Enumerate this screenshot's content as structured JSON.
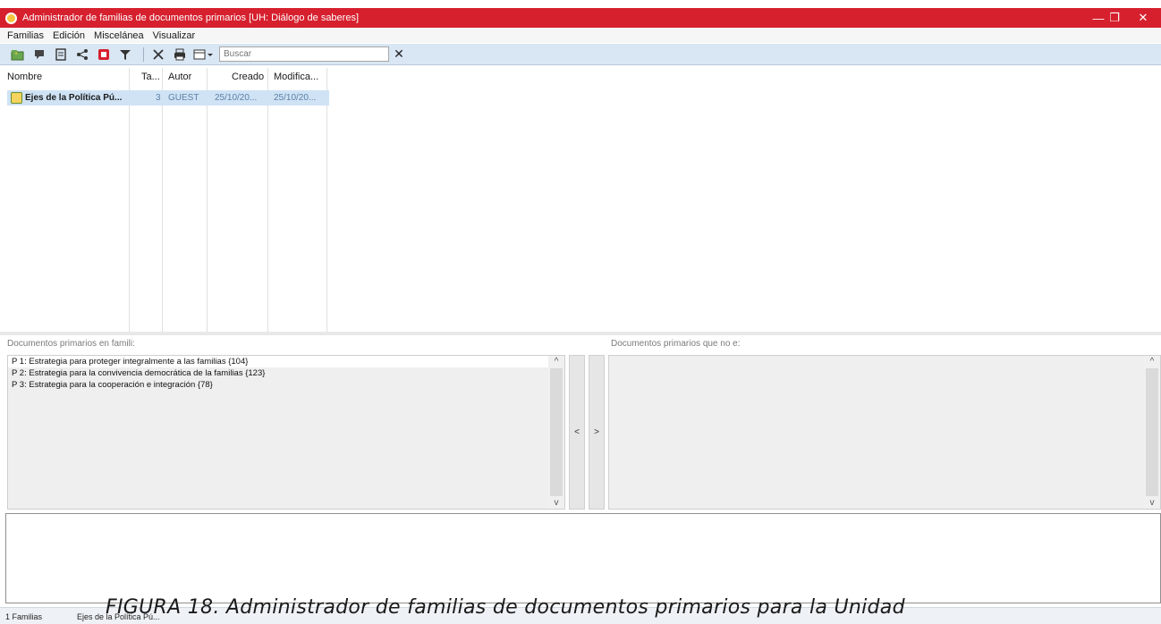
{
  "window": {
    "title": "Administrador de familias de documentos primarios [UH: Diálogo de saberes]",
    "minimize": "—",
    "maximize": "❐",
    "close": "✕"
  },
  "menu": [
    "Familias",
    "Edición",
    "Miscelánea",
    "Visualizar"
  ],
  "toolbar": {
    "icons": [
      "new-family-icon",
      "comment-icon",
      "document-icon",
      "network-icon",
      "record-icon",
      "filter-icon",
      "delete-icon",
      "print-icon",
      "view-icon"
    ],
    "search_placeholder": "Buscar",
    "search_clear": "✕"
  },
  "families_table": {
    "columns": [
      "Nombre",
      "Ta...",
      "Autor",
      "Creado",
      "Modifica..."
    ],
    "rows": [
      {
        "name": "Ejes de la Política Pú...",
        "size": "3",
        "author": "GUEST",
        "created": "25/10/20...",
        "modified": "25/10/20..."
      }
    ]
  },
  "left_pane": {
    "label": "Documentos primarios en famili:",
    "items": [
      "P 1: Estrategia para proteger integralmente a las familias {104}",
      "P 2: Estrategia para la convivencia democrática de la familias {123}",
      "P 3: Estrategia para la cooperación e integración {78}"
    ]
  },
  "right_pane": {
    "label": "Documentos primarios que no e:",
    "items": []
  },
  "move_buttons": {
    "left": "<",
    "right": ">"
  },
  "status": {
    "count": "1 Familias",
    "selected": "Ejes de la Política Pú..."
  },
  "caption": "FIGURA 18. Administrador de familias de documentos primarios para la Unidad"
}
